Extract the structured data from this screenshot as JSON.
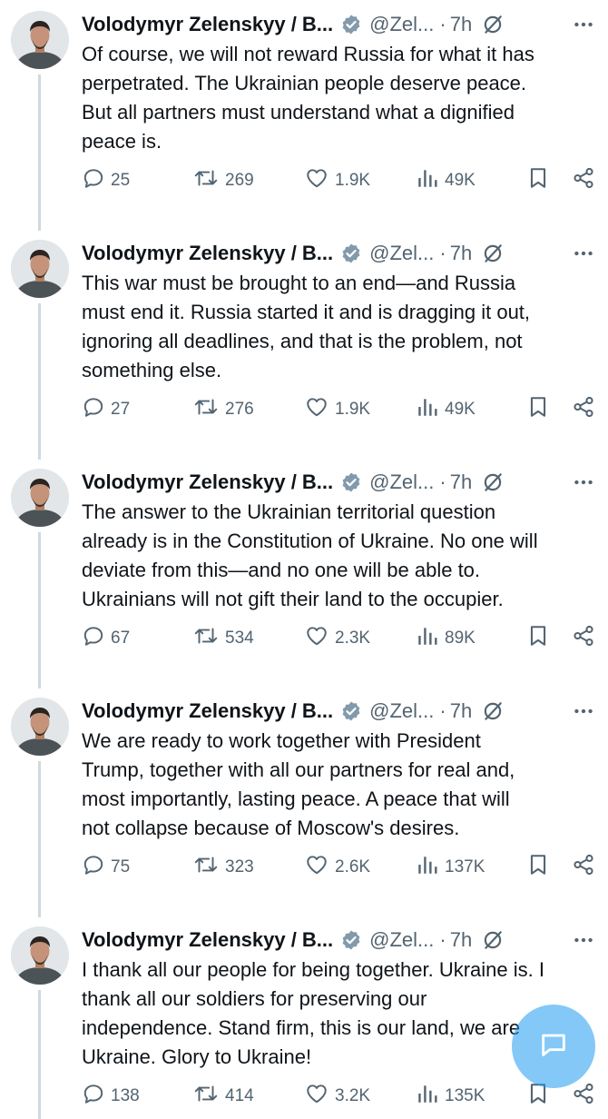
{
  "tweets": [
    {
      "author": "Volodymyr Zelenskyy / B...",
      "handle": "@Zel...",
      "sep": "·",
      "time": "7h",
      "text": "Of course, we will not reward Russia for what it has\nperpetrated. The Ukrainian people deserve peace.\nBut all partners must understand what a dignified\npeace is.",
      "replies": "25",
      "reposts": "269",
      "likes": "1.9K",
      "views": "49K"
    },
    {
      "author": "Volodymyr Zelenskyy / B...",
      "handle": "@Zel...",
      "sep": "·",
      "time": "7h",
      "text": "This war must be brought to an end—and Russia\nmust end it. Russia started it and is dragging it out,\nignoring all deadlines, and that is the problem, not\nsomething else.",
      "replies": "27",
      "reposts": "276",
      "likes": "1.9K",
      "views": "49K"
    },
    {
      "author": "Volodymyr Zelenskyy / B...",
      "handle": "@Zel...",
      "sep": "·",
      "time": "7h",
      "text": "The answer to the Ukrainian territorial question\nalready is in the Constitution of Ukraine. No one will\ndeviate from this—and no one will be able to.\nUkrainians will not gift their land to the occupier.",
      "replies": "67",
      "reposts": "534",
      "likes": "2.3K",
      "views": "89K"
    },
    {
      "author": "Volodymyr Zelenskyy / B...",
      "handle": "@Zel...",
      "sep": "·",
      "time": "7h",
      "text": "We are ready to work together with President\nTrump, together with all our partners for real and,\nmost importantly, lasting peace. A peace that will\nnot collapse because of Moscow's desires.",
      "replies": "75",
      "reposts": "323",
      "likes": "2.6K",
      "views": "137K"
    },
    {
      "author": "Volodymyr Zelenskyy / B...",
      "handle": "@Zel...",
      "sep": "·",
      "time": "7h",
      "text": "I thank all our people for being together. Ukraine is. I\nthank all our soldiers for preserving our\nindependence. Stand firm, this is our land, we are\nUkraine. Glory to Ukraine!",
      "replies": "138",
      "reposts": "414",
      "likes": "3.2K",
      "views": "135K"
    }
  ],
  "icons": {
    "verified": "verified-badge-icon",
    "grok": "grok-icon",
    "more": "more-icon",
    "reply": "reply-icon",
    "repost": "repost-icon",
    "like": "like-icon",
    "views": "views-icon",
    "bookmark": "bookmark-icon",
    "share": "share-icon",
    "compose": "compose-icon"
  },
  "colors": {
    "text": "#0f1419",
    "muted": "#536471",
    "verified": "#829aab",
    "accent": "#1d9bf0",
    "thread": "#cfd9de"
  }
}
